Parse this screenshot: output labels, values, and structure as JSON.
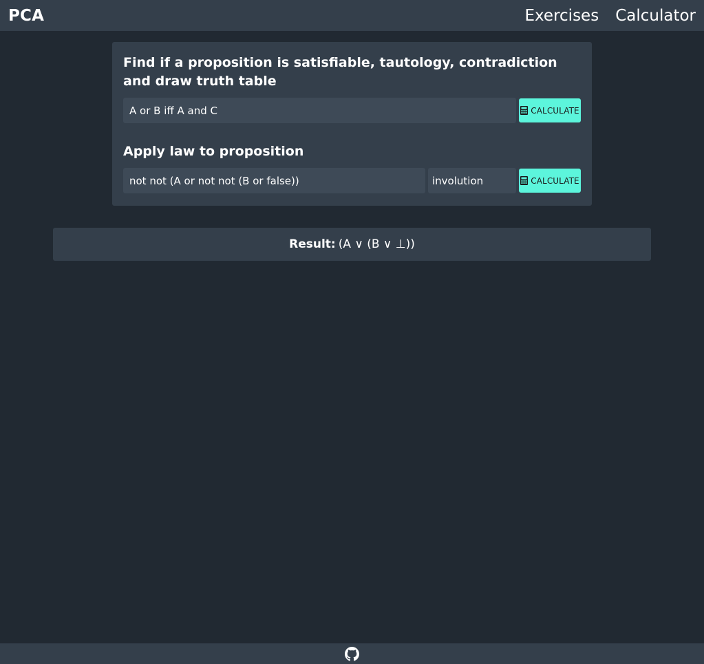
{
  "navbar": {
    "brand": "PCA",
    "links": [
      {
        "label": "Exercises"
      },
      {
        "label": "Calculator"
      }
    ]
  },
  "satisfiability": {
    "title": "Find if a proposition is satisfiable, tautology, contradiction and draw truth table",
    "input_value": "A or B iff A and C",
    "button_label": "CALCULATE",
    "button_icon": "calculator-icon"
  },
  "apply_law": {
    "title": "Apply law to proposition",
    "input_value": "not not (A or not not (B or false))",
    "law_selected": "involution",
    "button_label": "CALCULATE",
    "button_icon": "calculator-icon"
  },
  "result": {
    "label": "Result:",
    "value": "(A ∨ (B ∨ ⊥))"
  },
  "footer": {
    "icon": "github-icon"
  },
  "colors": {
    "background": "#212932",
    "panel": "#343f4b",
    "input": "#3e4a57",
    "accent": "#5cf5dc"
  }
}
